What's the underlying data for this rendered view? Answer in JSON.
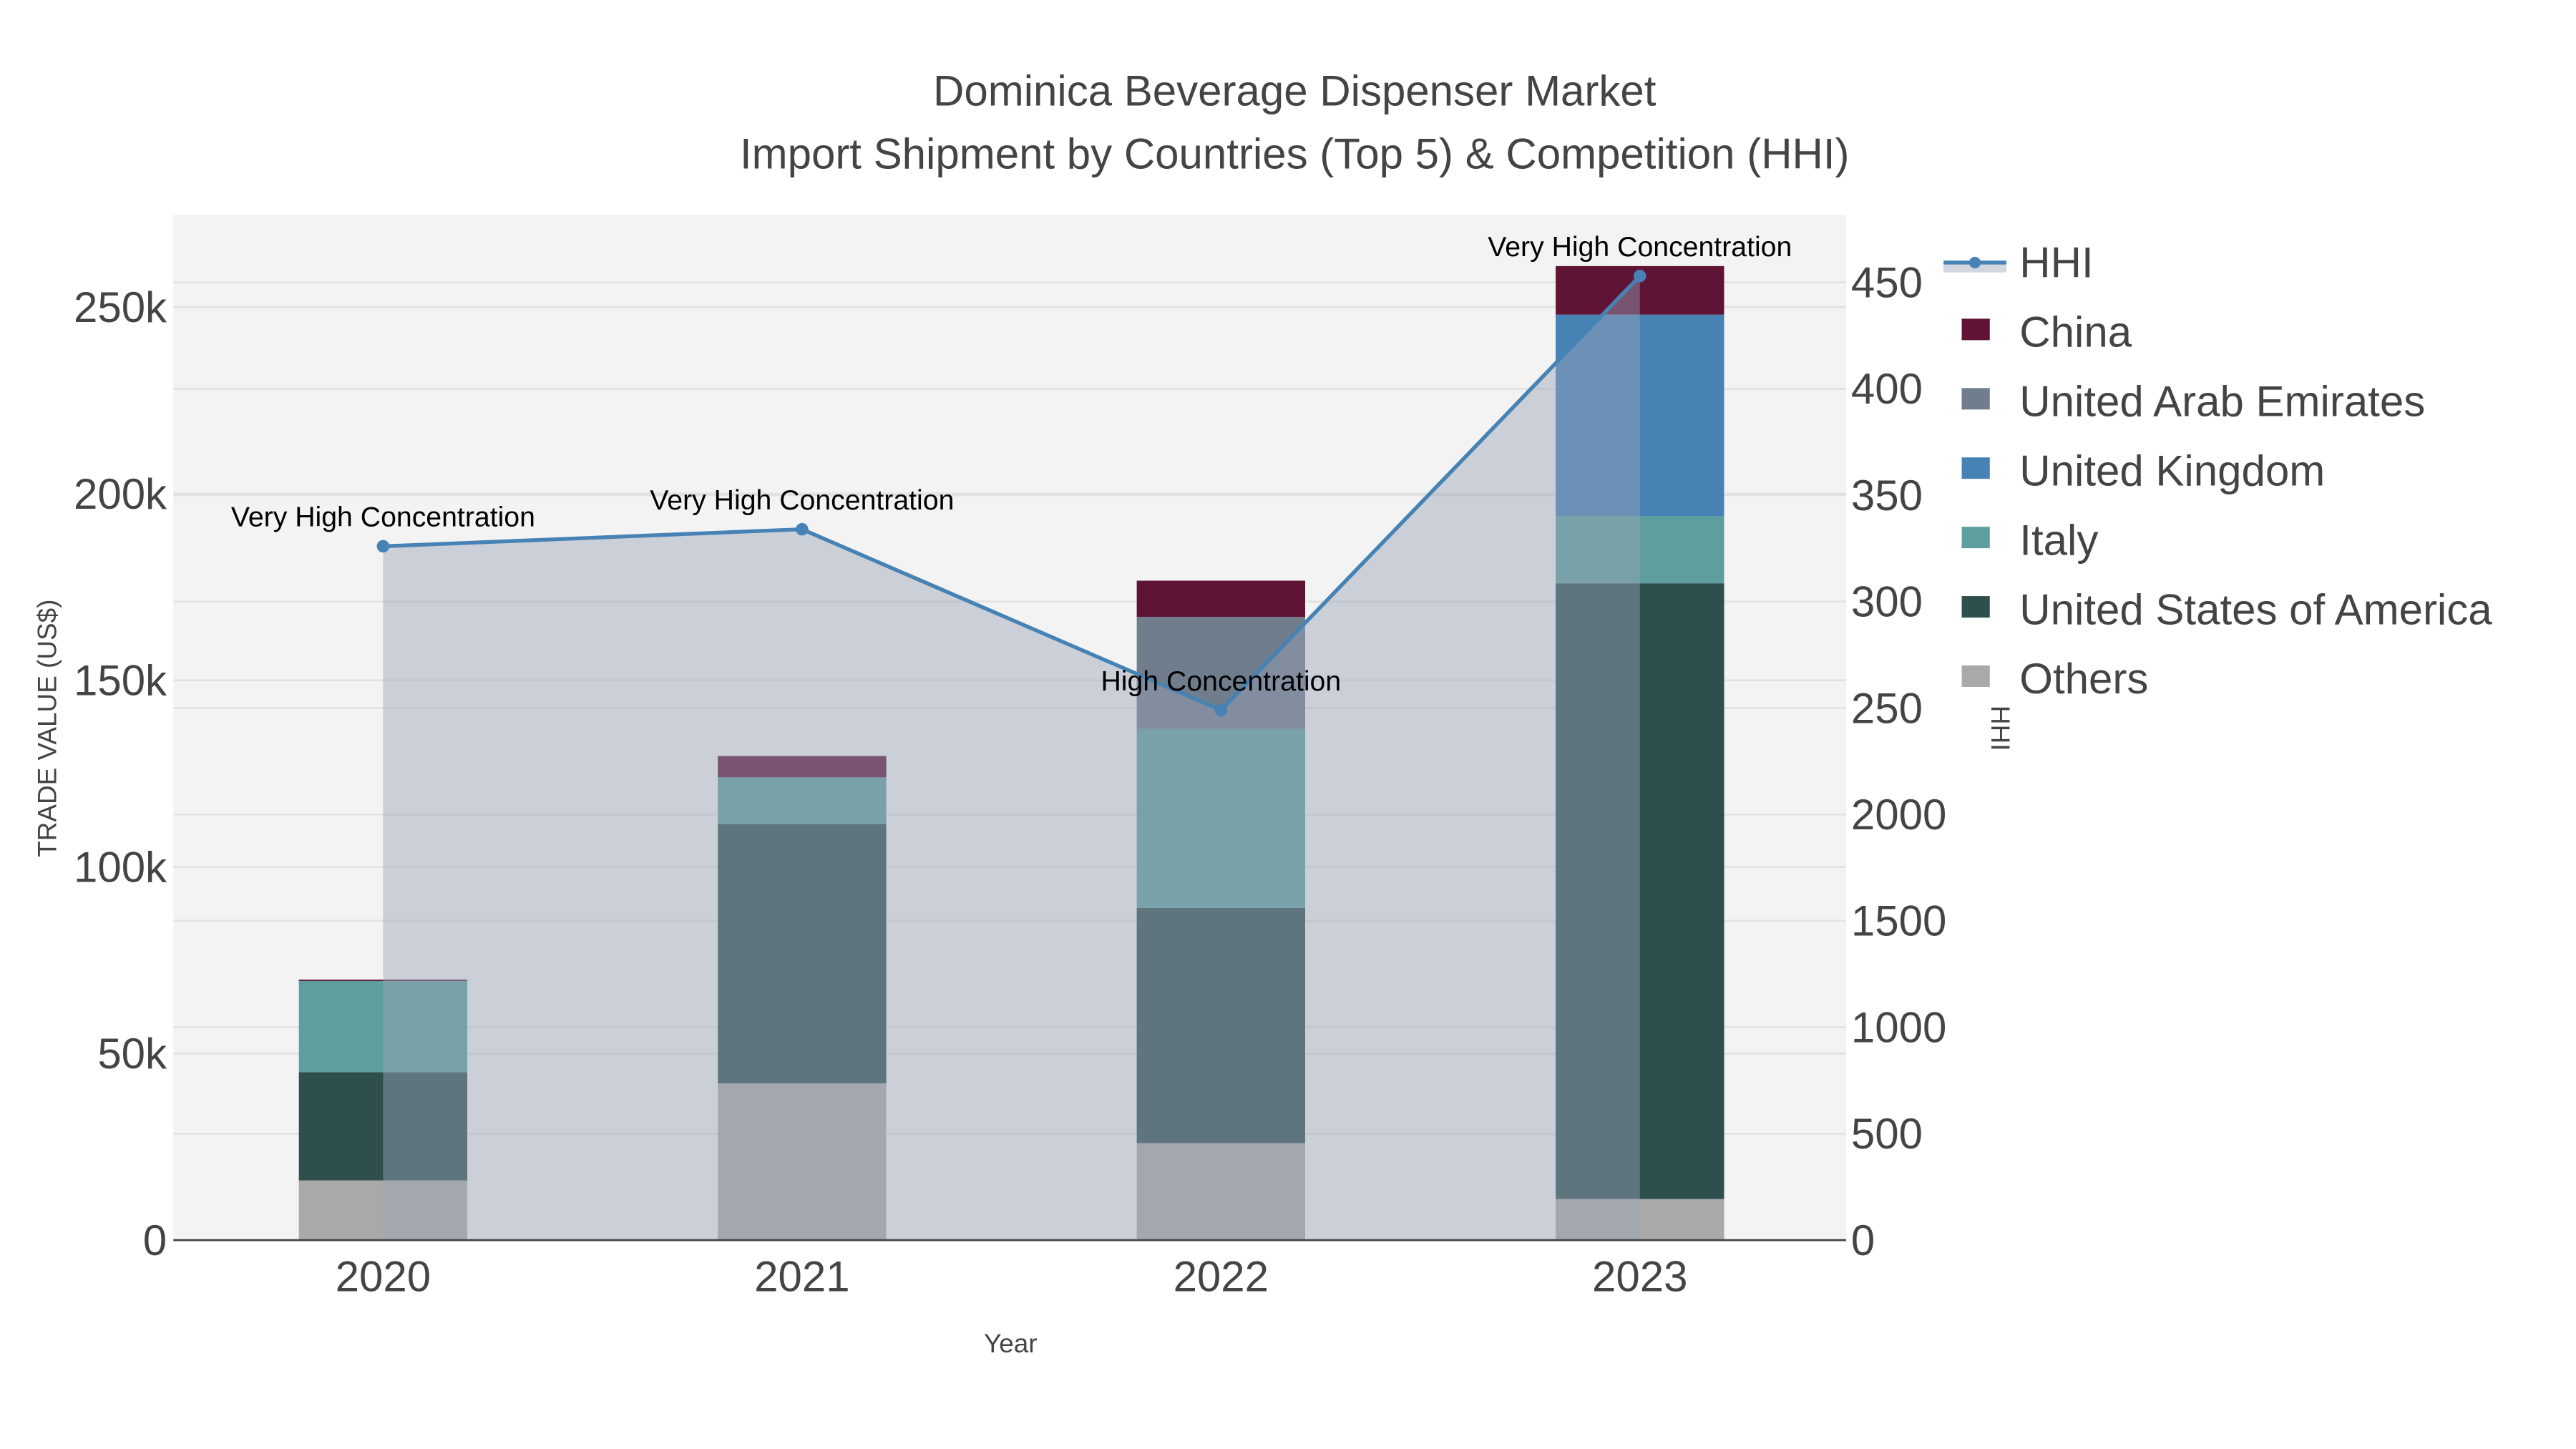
{
  "chart_data": {
    "type": "bar",
    "title": "Dominica Beverage Dispenser Market",
    "subtitle": "Import Shipment by Countries (Top 5) & Competition (HHI)",
    "xlabel": "Year",
    "ylabel": "TRADE VALUE (US$)",
    "y2label": "HHI",
    "categories": [
      "2020",
      "2021",
      "2022",
      "2023"
    ],
    "ylim": [
      0,
      275000
    ],
    "yticks": [
      0,
      50000,
      100000,
      150000,
      200000,
      250000
    ],
    "ytick_labels": [
      "0",
      "50k",
      "100k",
      "150k",
      "200k",
      "250k"
    ],
    "y2lim": [
      0,
      4800
    ],
    "y2ticks": [
      0,
      500,
      1000,
      1500,
      2000,
      2500,
      3000,
      3500,
      4000,
      4500
    ],
    "y2tick_labels": [
      "0",
      "500",
      "1000",
      "1500",
      "2000",
      "250",
      "300",
      "350",
      "400",
      "450"
    ],
    "stacked": true,
    "grid": true,
    "legend_position": "right",
    "series": [
      {
        "name": "Others",
        "color": "#a9a9a9",
        "values": [
          16000,
          42000,
          26000,
          11000
        ]
      },
      {
        "name": "United States of America",
        "color": "#2f4f4f",
        "values": [
          29000,
          69500,
          63000,
          165000
        ]
      },
      {
        "name": "Italy",
        "color": "#5f9e9e",
        "values": [
          24500,
          12500,
          48000,
          18000
        ]
      },
      {
        "name": "United Kingdom",
        "color": "#4682b4",
        "values": [
          0,
          0,
          0,
          54000
        ]
      },
      {
        "name": "United Arab Emirates",
        "color": "#6f7d8c",
        "values": [
          0,
          0,
          30000,
          0
        ]
      },
      {
        "name": "China",
        "color": "#5f1335",
        "values": [
          300,
          5700,
          9700,
          13000
        ]
      }
    ],
    "hhi": {
      "name": "HHI",
      "color": "#4682b4",
      "values": [
        3260,
        3340,
        2490,
        4530
      ],
      "annotations": [
        "Very High Concentration",
        "Very High Concentration",
        "High Concentration",
        "Very High Concentration"
      ]
    },
    "legend_order": [
      "HHI",
      "China",
      "United Arab Emirates",
      "United Kingdom",
      "Italy",
      "United States of America",
      "Others"
    ]
  }
}
